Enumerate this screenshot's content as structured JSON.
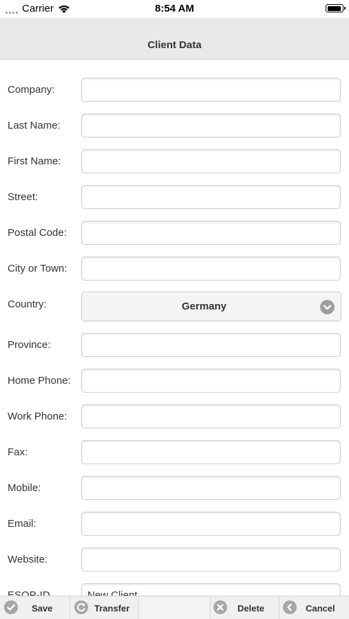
{
  "status_bar": {
    "carrier": "Carrier",
    "time": "8:54 AM"
  },
  "header": {
    "title": "Client Data"
  },
  "form": {
    "company_label": "Company:",
    "last_name_label": "Last Name:",
    "first_name_label": "First Name:",
    "street_label": "Street:",
    "postal_code_label": "Postal Code:",
    "city_label": "City or Town:",
    "country_label": "Country:",
    "country_value": "Germany",
    "province_label": "Province:",
    "home_phone_label": "Home Phone:",
    "work_phone_label": "Work Phone:",
    "fax_label": "Fax:",
    "mobile_label": "Mobile:",
    "email_label": "Email:",
    "website_label": "Website:",
    "esop_label": "ESOP-ID",
    "esop_value": "New Client"
  },
  "toolbar": {
    "save_label": "Save",
    "transfer_label": "Transfer",
    "delete_label": "Delete",
    "cancel_label": "Cancel"
  },
  "icons": {
    "save": "check-circle-icon",
    "transfer": "refresh-icon",
    "delete": "x-circle-icon",
    "cancel": "back-arrow-icon",
    "country_select": "chevron-down-icon"
  }
}
